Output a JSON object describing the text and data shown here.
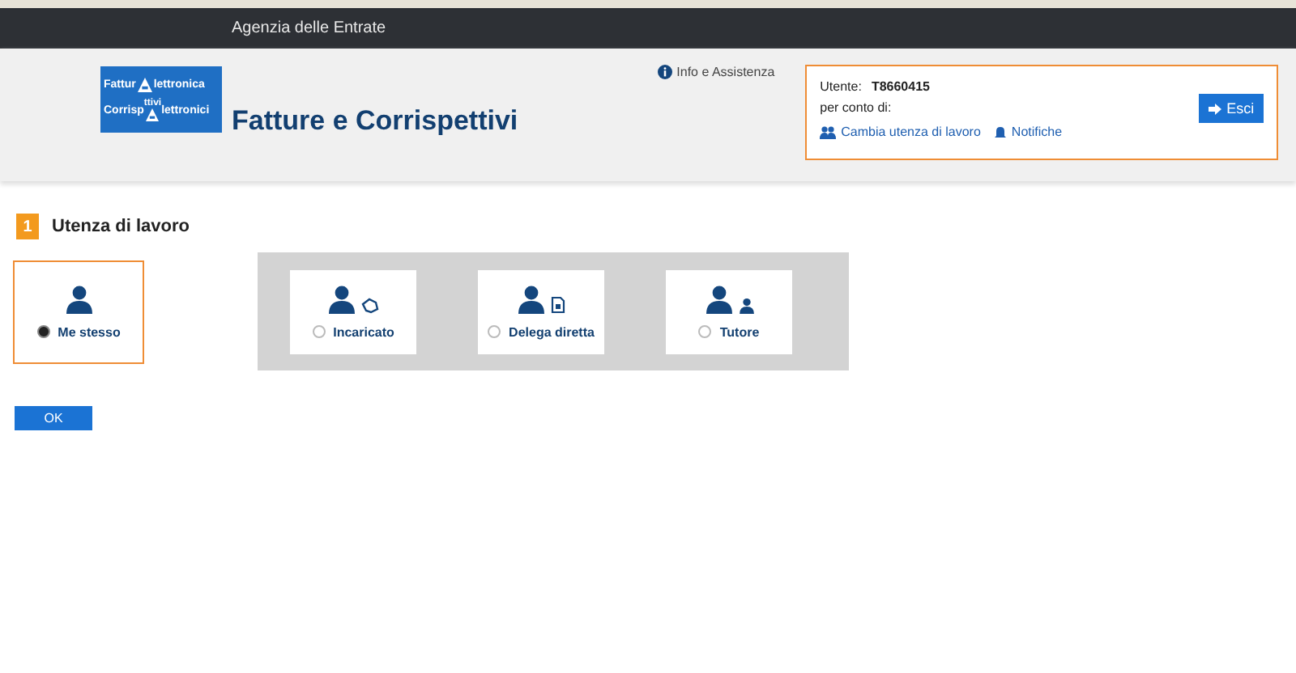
{
  "top_bar": {
    "title": "Agenzia delle Entrate"
  },
  "logo": {
    "line_1": [
      "Fattur",
      "lettronica"
    ],
    "line_2": [
      "Corrisp",
      "ttivi",
      "lettronici"
    ]
  },
  "app_title": "Fatture e Corrispettivi",
  "info_link": "Info e Assistenza",
  "user_box": {
    "user_label": "Utente:",
    "user_id": "T8660415",
    "on_behalf": "per conto di:",
    "change_link": "Cambia utenza di lavoro",
    "notifications_link": "Notifiche",
    "exit_button": "Esci"
  },
  "step": {
    "number": "1",
    "title": "Utenza di lavoro"
  },
  "options": [
    {
      "kind": "self",
      "label": "Me stesso",
      "selected": true
    },
    {
      "kind": "appointee",
      "label": "Incaricato",
      "selected": false
    },
    {
      "kind": "delegate",
      "label": "Delega diretta",
      "selected": false
    },
    {
      "kind": "tutor",
      "label": "Tutore",
      "selected": false
    }
  ],
  "ok_button": "OK"
}
